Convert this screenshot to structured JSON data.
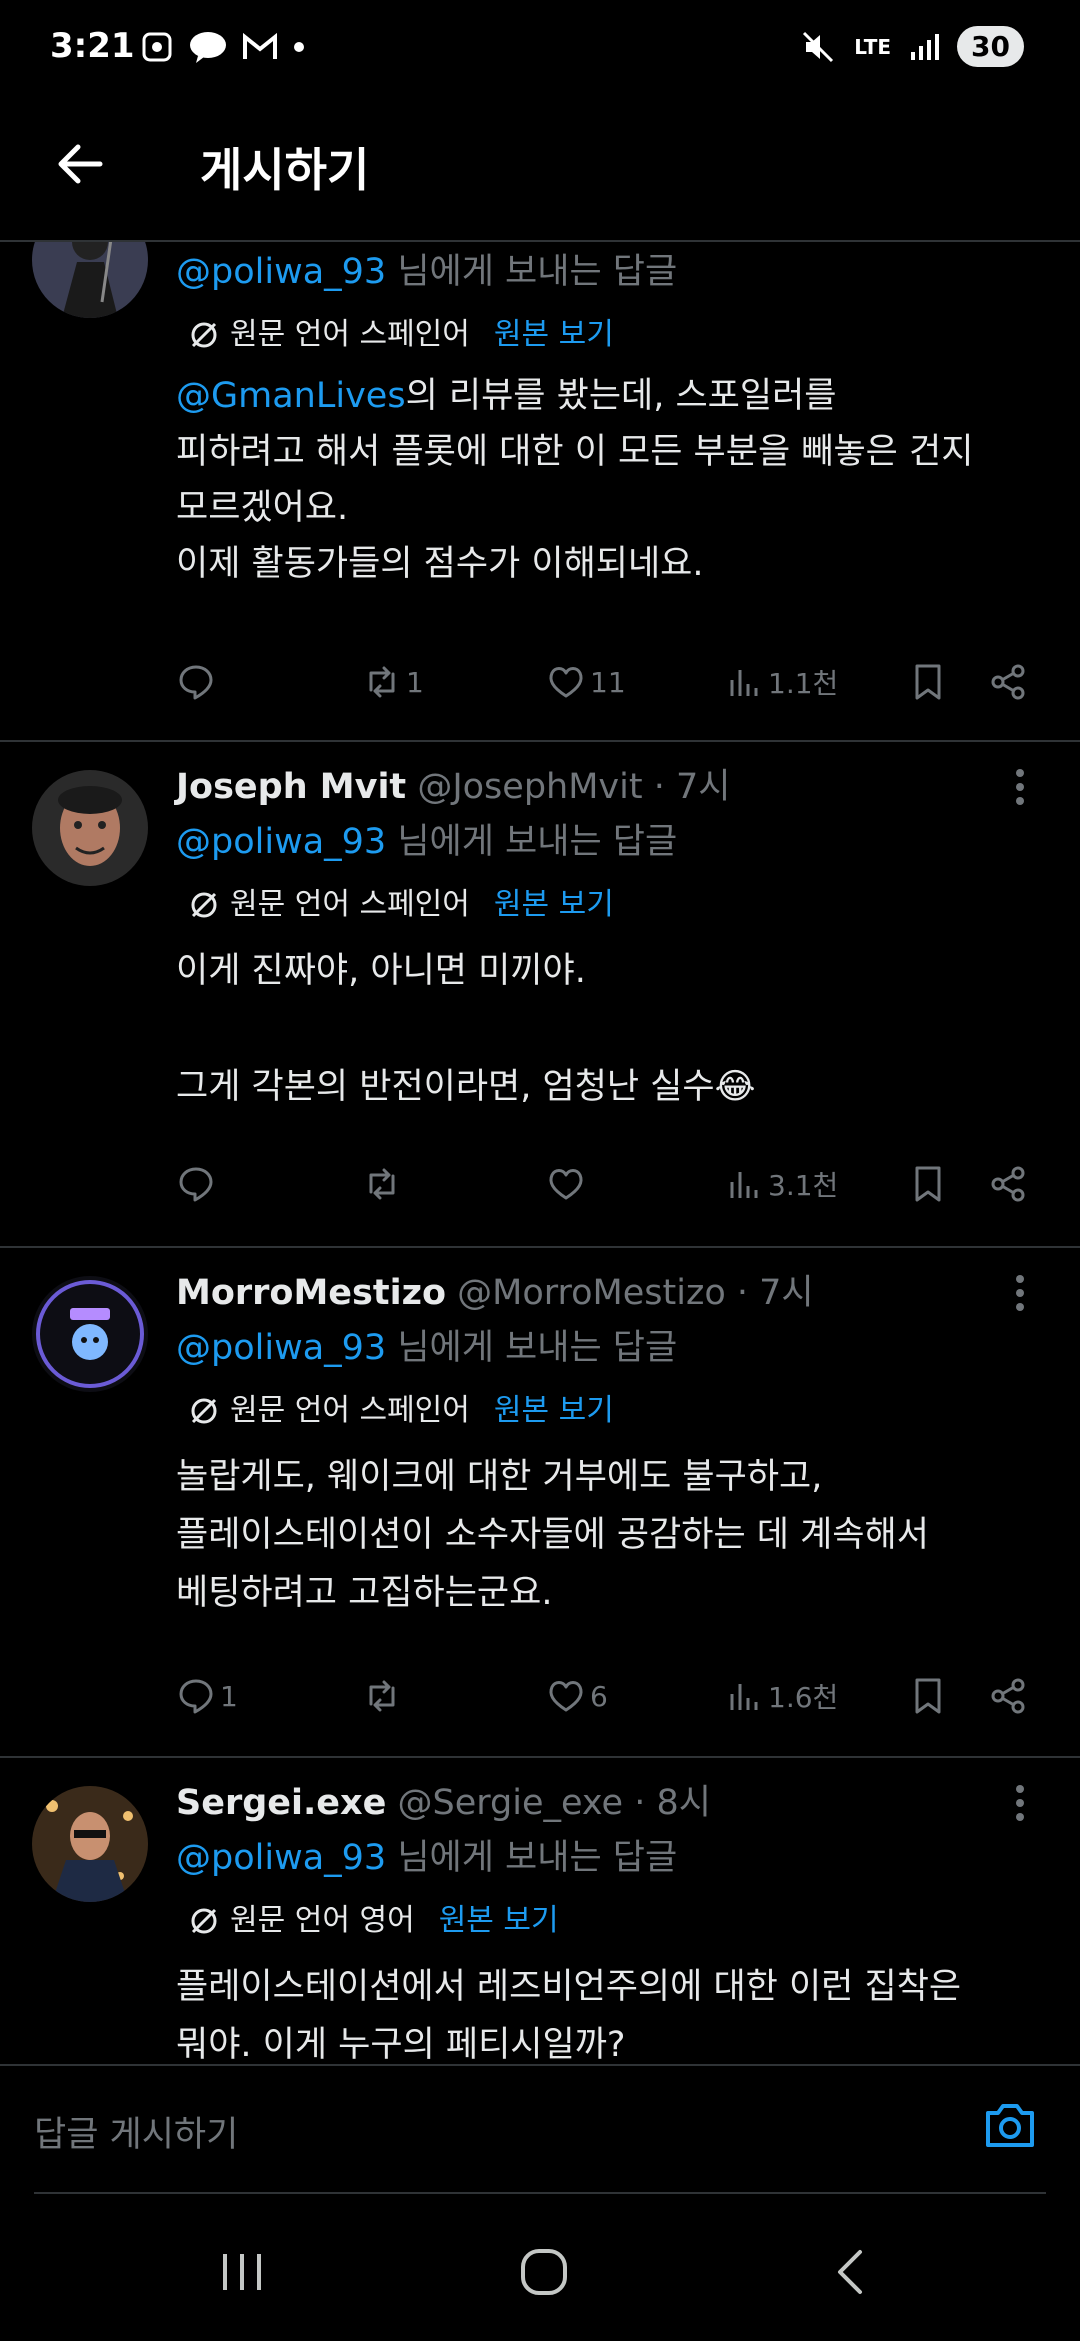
{
  "status_bar": {
    "time": "3:21",
    "battery": "30",
    "network": "LTE"
  },
  "header": {
    "title": "게시하기"
  },
  "posts": [
    {
      "name": "",
      "handle": "",
      "time": "",
      "reply_prefix": "@poliwa_93",
      "reply_suffix": " 님에게 보내는 답글",
      "translate_label": "원문 언어 스페인어",
      "show_original": "원본 보기",
      "mention": "@GmanLives",
      "text": "의 리뷰를 봤는데, 스포일러를\n피하려고 해서 플롯에 대한 이 모든 부분을 빼놓은 건지\n모르겠어요.\n이제 활동가들의 점수가 이해되네요.",
      "replies": "",
      "retweets": "1",
      "likes": "11",
      "views": "1.1천"
    },
    {
      "name": "Joseph Mvit",
      "handle": "@JosephMvit",
      "time": "· 7시",
      "reply_prefix": "@poliwa_93",
      "reply_suffix": " 님에게 보내는 답글",
      "translate_label": "원문 언어 스페인어",
      "show_original": "원본 보기",
      "text": "이게 진짜야, 아니면 미끼야.\n\n그게 각본의 반전이라면, 엄청난 실수😂",
      "replies": "",
      "retweets": "",
      "likes": "",
      "views": "3.1천"
    },
    {
      "name": "MorroMestizo",
      "handle": "@MorroMestizo",
      "time": "· 7시",
      "reply_prefix": "@poliwa_93",
      "reply_suffix": " 님에게 보내는 답글",
      "translate_label": "원문 언어 스페인어",
      "show_original": "원본 보기",
      "text": "놀랍게도, 웨이크에 대한 거부에도 불구하고,\n플레이스테이션이 소수자들에 공감하는 데 계속해서\n베팅하려고 고집하는군요.",
      "replies": "1",
      "retweets": "",
      "likes": "6",
      "views": "1.6천"
    },
    {
      "name": "Sergei.exe",
      "handle": "@Sergie_exe",
      "time": "· 8시",
      "reply_prefix": "@poliwa_93",
      "reply_suffix": " 님에게 보내는 답글",
      "translate_label": "원문 언어 영어",
      "show_original": "원본 보기",
      "text": "플레이스테이션에서 레즈비언주의에 대한 이런 집착은\n뭐야. 이게 누구의 페티시일까?"
    }
  ],
  "composer": {
    "placeholder": "답글 게시하기"
  },
  "colors": {
    "background": "#000000",
    "accent": "#1d9bf0",
    "muted": "#71767b",
    "divider": "#2f3336"
  },
  "icons": [
    "back-arrow-icon",
    "reply-icon",
    "retweet-icon",
    "like-icon",
    "views-icon",
    "bookmark-icon",
    "share-icon",
    "more-icon",
    "translate-icon",
    "camera-icon"
  ]
}
